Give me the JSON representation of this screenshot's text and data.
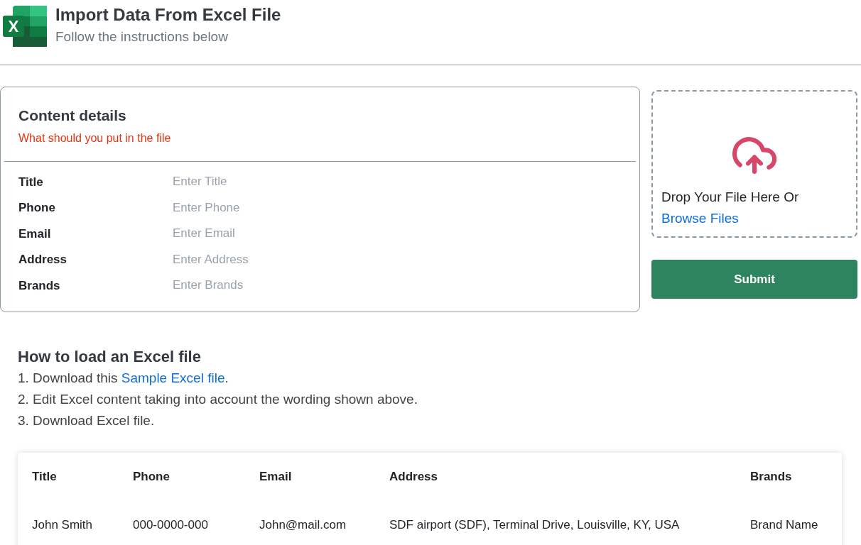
{
  "header": {
    "title": "Import Data From Excel File",
    "subtitle": "Follow the instructions below"
  },
  "content_details": {
    "title": "Content details",
    "subtitle": "What should you put in the file",
    "fields": [
      {
        "label": "Title",
        "placeholder": "Enter Title"
      },
      {
        "label": "Phone",
        "placeholder": "Enter Phone"
      },
      {
        "label": "Email",
        "placeholder": "Enter Email"
      },
      {
        "label": "Address",
        "placeholder": "Enter Address"
      },
      {
        "label": "Brands",
        "placeholder": "Enter Brands"
      }
    ]
  },
  "upload": {
    "text": "Drop Your File Here Or",
    "link": "Browse Files"
  },
  "submit_button": "Submit",
  "instructions": {
    "title": "How to load an Excel file",
    "steps": [
      {
        "text": "1. Download this ",
        "link": "Sample Excel file",
        "after": "."
      },
      {
        "text": "2. Edit Excel content taking into account the wording shown above."
      },
      {
        "text": "3. Download Excel file."
      }
    ]
  },
  "table": {
    "columns": [
      "Title",
      "Phone",
      "Email",
      "Address",
      "Brands"
    ],
    "rows": [
      [
        "John Smith",
        "000-0000-000",
        "John@mail.com",
        "SDF airport (SDF), Terminal Drive, Louisville, KY, USA",
        "Brand Name"
      ]
    ]
  }
}
